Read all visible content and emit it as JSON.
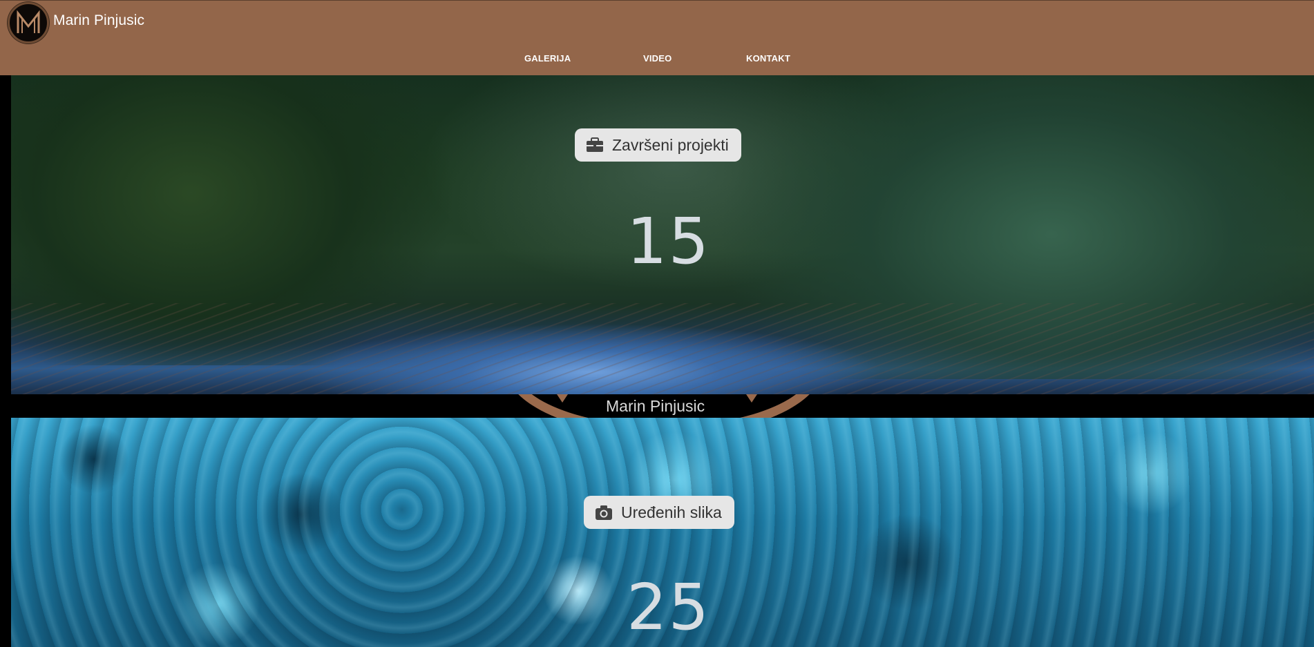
{
  "header": {
    "brand": "Marin Pinjusic",
    "logo_icon": "monogram-m-logo",
    "nav": [
      {
        "label": "GALERIJA"
      },
      {
        "label": "VIDEO"
      },
      {
        "label": "KONTAKT"
      }
    ]
  },
  "counters": [
    {
      "icon": "briefcase-icon",
      "label": "Završeni projekti",
      "value": "15"
    },
    {
      "icon": "camera-icon",
      "label": "Uređenih slika",
      "value": "25"
    }
  ],
  "strip": {
    "name": "Marin Pinjusic"
  },
  "colors": {
    "header_bg": "#93664a",
    "accent": "#9a6a4c",
    "pill_bg": "#e6e6e6"
  }
}
